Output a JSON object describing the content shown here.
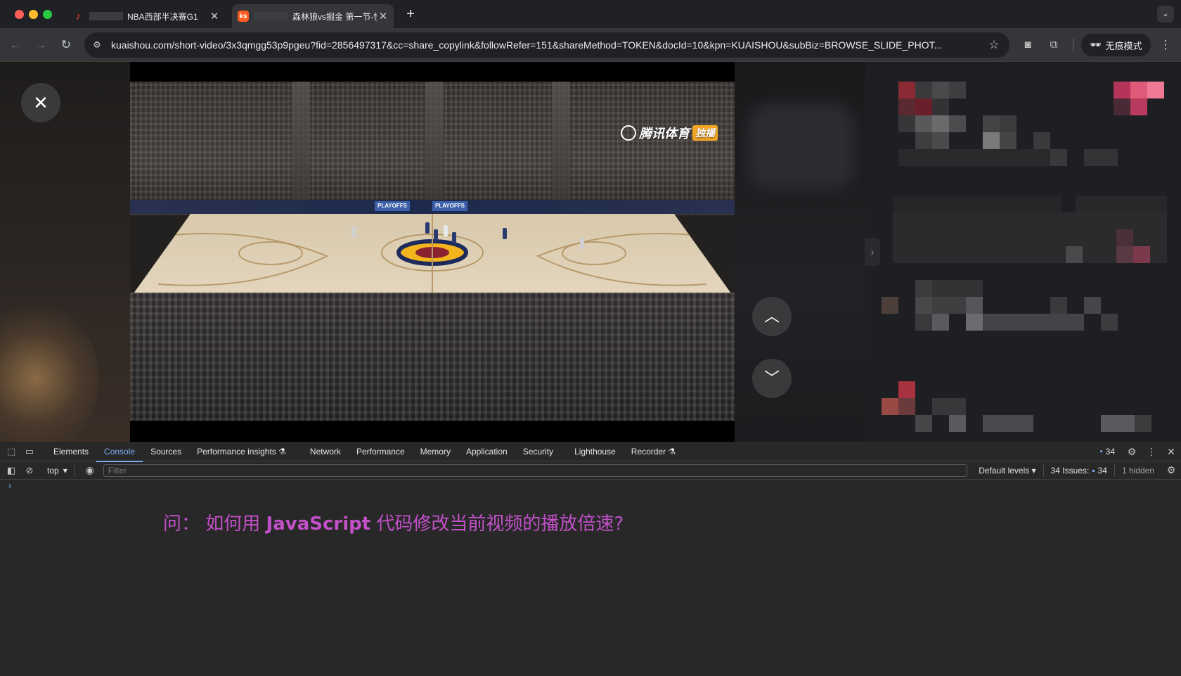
{
  "browser": {
    "tabs": [
      {
        "title": "NBA西部半决赛G1"
      },
      {
        "title": "森林狼vs掘金 第一节-快"
      }
    ],
    "url": "kuaishou.com/short-video/3x3qmgg53p9pgeu?fid=2856497317&cc=share_copylink&followRefer=151&shareMethod=TOKEN&docId=10&kpn=KUAISHOU&subBiz=BROWSE_SLIDE_PHOT...",
    "incognito_label": "无痕模式"
  },
  "video": {
    "watermark_text": "腾讯体育",
    "watermark_badge": "独播",
    "banners": [
      "PLAYOFFS",
      "PLAYOFFS"
    ]
  },
  "devtools": {
    "tabs": [
      {
        "label": "Elements"
      },
      {
        "label": "Console"
      },
      {
        "label": "Sources"
      },
      {
        "label": "Performance insights"
      },
      {
        "label": "Network"
      },
      {
        "label": "Performance"
      },
      {
        "label": "Memory"
      },
      {
        "label": "Application"
      },
      {
        "label": "Security"
      },
      {
        "label": "Lighthouse"
      },
      {
        "label": "Recorder"
      }
    ],
    "active_tab": "Console",
    "issue_count": "34",
    "context": "top",
    "filter_placeholder": "Filter",
    "levels": "Default levels",
    "issues_label": "34 Issues:",
    "issues_count": "34",
    "hidden": "1 hidden",
    "prompt": "›"
  },
  "question": {
    "prefix": "问：  如何用 ",
    "highlight": "JavaScript",
    "suffix": " 代码修改当前视频的播放倍速?"
  },
  "colors": {
    "question": "#c250c9",
    "active_tab": "#7cacf8"
  }
}
